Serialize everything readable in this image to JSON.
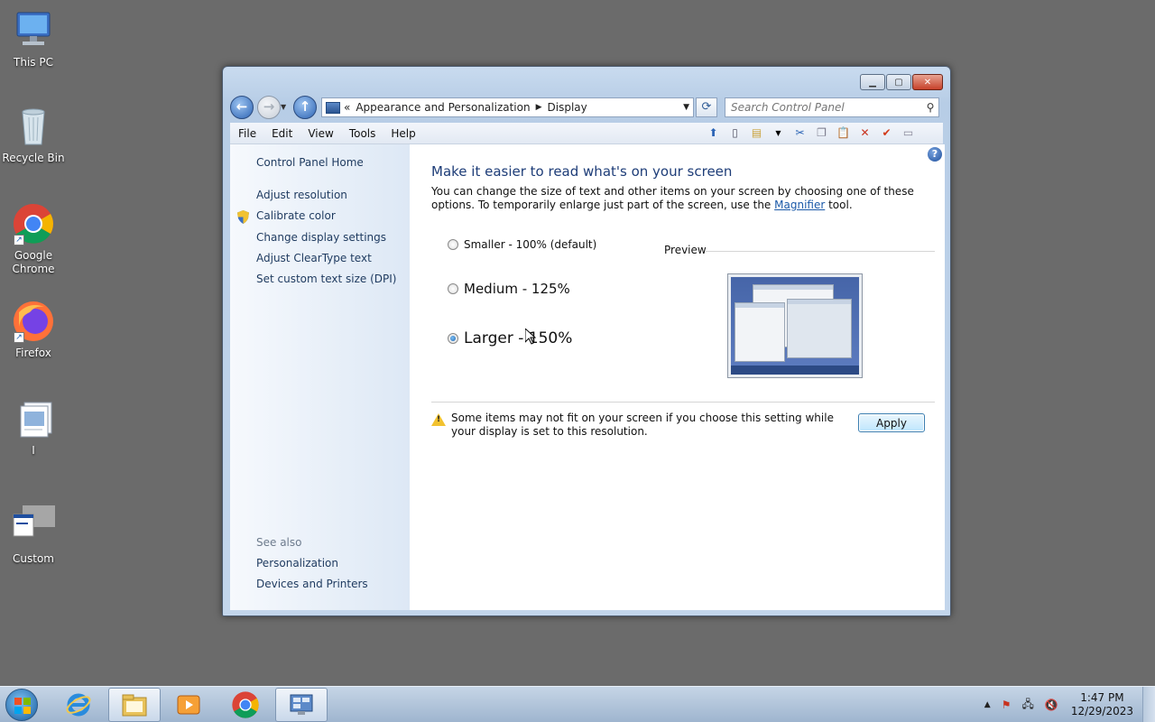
{
  "desktop": {
    "icons": [
      {
        "label": "This PC"
      },
      {
        "label": "Recycle Bin"
      },
      {
        "label": "Google Chrome"
      },
      {
        "label": "Firefox"
      },
      {
        "label": "I"
      },
      {
        "label": "Custom"
      }
    ]
  },
  "window": {
    "address": {
      "overflow": "«",
      "crumb1": "Appearance and Personalization",
      "crumb2": "Display"
    },
    "search": {
      "placeholder": "Search Control Panel"
    },
    "menu": [
      "File",
      "Edit",
      "View",
      "Tools",
      "Help"
    ],
    "sidebar": {
      "home": "Control Panel Home",
      "links": [
        "Adjust resolution",
        "Calibrate color",
        "Change display settings",
        "Adjust ClearType text",
        "Set custom text size (DPI)"
      ],
      "see_also_title": "See also",
      "see_also": [
        "Personalization",
        "Devices and Printers"
      ]
    },
    "main": {
      "title": "Make it easier to read what's on your screen",
      "desc_before": "You can change the size of text and other items on your screen by choosing one of these options. To temporarily enlarge just part of the screen, use the ",
      "desc_link": "Magnifier",
      "desc_after": " tool.",
      "options": [
        {
          "label": "Smaller - 100% (default)",
          "selected": false
        },
        {
          "label": "Medium - 125%",
          "selected": false
        },
        {
          "label": "Larger - 150%",
          "selected": true
        }
      ],
      "preview_label": "Preview",
      "warning": "Some items may not fit on your screen if you choose this setting while your display is set to this resolution.",
      "apply": "Apply"
    }
  },
  "taskbar": {
    "clock_time": "1:47 PM",
    "clock_date": "12/29/2023"
  },
  "colors": {
    "desktop": "#6b6b6b",
    "link": "#1e3a5f",
    "title": "#1e3d78"
  }
}
